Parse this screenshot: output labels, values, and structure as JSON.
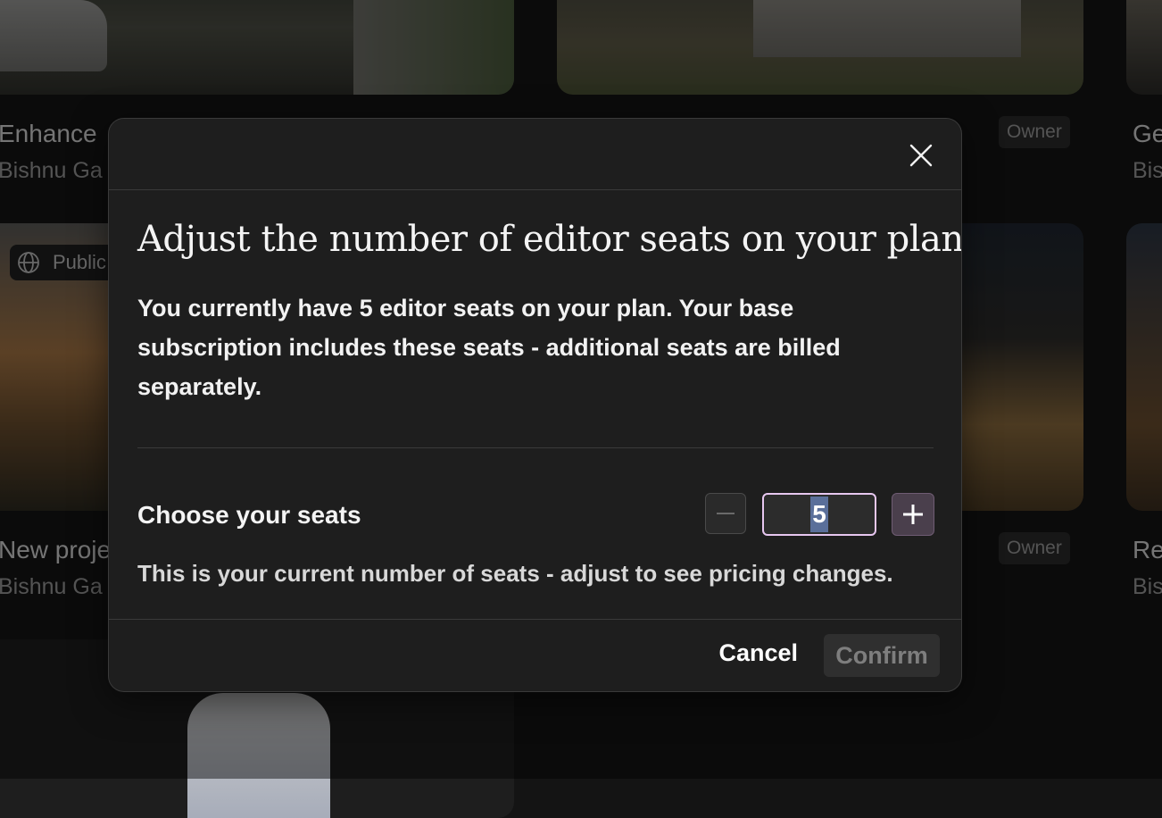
{
  "gallery": {
    "cards": [
      {
        "title": "Enhance",
        "author": "Bishnu Ga"
      },
      {
        "title": "Ge",
        "author": "Bis"
      },
      {
        "title": "New proje",
        "author": "Bishnu Ga"
      },
      {
        "title": "Re",
        "author": "Bis"
      }
    ],
    "owner_badges": [
      "Owner",
      "Owner"
    ],
    "public_badge": {
      "label": "Public",
      "icon": "globe-icon"
    }
  },
  "modal": {
    "title": "Adjust the number of editor seats on your plan",
    "description": "You currently have 5 editor seats on your plan. Your base subscription includes these seats - additional seats are billed separately.",
    "close_icon": "close-icon",
    "seats": {
      "label": "Choose your seats",
      "value": "5",
      "hint": "This is your current number of seats - adjust to see pricing changes.",
      "minus_icon": "minus-icon",
      "plus_icon": "plus-icon"
    },
    "footer": {
      "cancel_label": "Cancel",
      "confirm_label": "Confirm"
    }
  },
  "colors": {
    "accent_border": "#e7c7f0",
    "plus_button": "#4a3f4c",
    "selection": "#5a6f9a"
  }
}
